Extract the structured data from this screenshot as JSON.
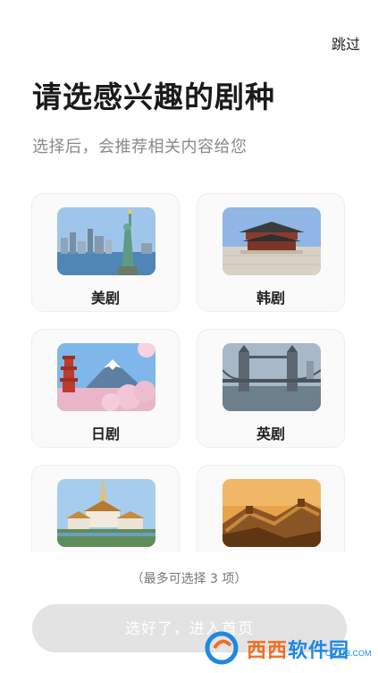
{
  "header": {
    "skip_label": "跳过"
  },
  "title": "请选感兴趣的剧种",
  "subtitle": "选择后，会推荐相关内容给您",
  "categories": [
    {
      "label": "美剧",
      "image": "statue-of-liberty-new-york"
    },
    {
      "label": "韩剧",
      "image": "korean-palace"
    },
    {
      "label": "日剧",
      "image": "mount-fuji-pagoda-cherry-blossom"
    },
    {
      "label": "英剧",
      "image": "tower-bridge-london"
    },
    {
      "label": "",
      "image": "thai-temple"
    },
    {
      "label": "",
      "image": "great-wall"
    }
  ],
  "note": "（最多可选择 3 项）",
  "confirm_button": "选好了，进入首页",
  "watermark": {
    "text_a": "西西",
    "text_b": "软件园",
    "url": "CR173.COM"
  }
}
